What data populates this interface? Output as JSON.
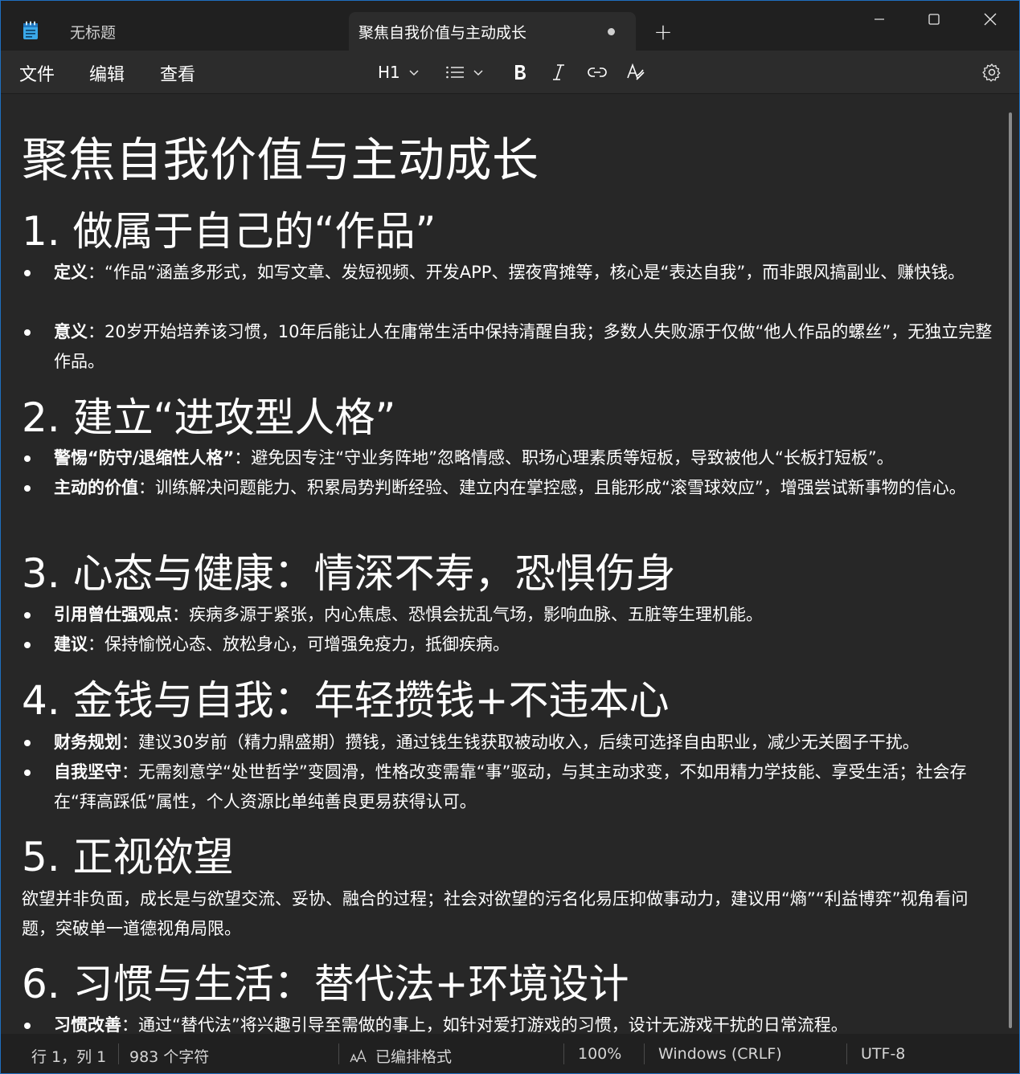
{
  "tabs": [
    {
      "label": "无标题"
    },
    {
      "label": "聚焦自我价值与主动成长"
    }
  ],
  "menu": {
    "file": "文件",
    "edit": "编辑",
    "view": "查看"
  },
  "toolbar": {
    "heading": "H1"
  },
  "doc": {
    "title": "聚焦自我价值与主动成长",
    "s1": {
      "heading": "1. 做属于自己的“作品”",
      "b1_label": "定义",
      "b1_text": "：“作品”涵盖多形式，如写文章、发短视频、开发APP、摆夜宵摊等，核心是“表达自我”，而非跟风搞副业、赚快钱。",
      "b2_label": "意义",
      "b2_text": "：20岁开始培养该习惯，10年后能让人在庸常生活中保持清醒自我；多数人失败源于仅做“他人作品的螺丝”，无独立完整作品。"
    },
    "s2": {
      "heading": "2. 建立“进攻型人格”",
      "b1_label": "警惕“防守/退缩性人格”",
      "b1_text": "：避免因专注“守业务阵地”忽略情感、职场心理素质等短板，导致被他人“长板打短板”。",
      "b2_label": "主动的价值",
      "b2_text": "：训练解决问题能力、积累局势判断经验、建立内在掌控感，且能形成“滚雪球效应”，增强尝试新事物的信心。"
    },
    "s3": {
      "heading": "3. 心态与健康：情深不寿，恐惧伤身",
      "b1_label": "引用曾仕强观点",
      "b1_text": "：疾病多源于紧张，内心焦虑、恐惧会扰乱气场，影响血脉、五脏等生理机能。",
      "b2_label": "建议",
      "b2_text": "：保持愉悦心态、放松身心，可增强免疫力，抵御疾病。"
    },
    "s4": {
      "heading": "4. 金钱与自我：年轻攒钱+不违本心",
      "b1_label": "财务规划",
      "b1_text": "：建议30岁前（精力鼎盛期）攒钱，通过钱生钱获取被动收入，后续可选择自由职业，减少无关圈子干扰。",
      "b2_label": "自我坚守",
      "b2_text": "：无需刻意学“处世哲学”变圆滑，性格改变需靠“事”驱动，与其主动求变，不如用精力学技能、享受生活；社会存在“拜高踩低”属性，个人资源比单纯善良更易获得认可。"
    },
    "s5": {
      "heading": "5. 正视欲望",
      "para": "欲望并非负面，成长是与欲望交流、妥协、融合的过程；社会对欲望的污名化易压抑做事动力，建议用“熵”“利益博弈”视角看问题，突破单一道德视角局限。"
    },
    "s6": {
      "heading": "6. 习惯与生活：替代法+环境设计",
      "b1_label": "习惯改善",
      "b1_text": "：通过“替代法”将兴趣引导至需做的事上，如针对爱打游戏的习惯，设计无游戏干扰的日常流程。"
    }
  },
  "status": {
    "position": "行 1，列 1",
    "chars": "983 个字符",
    "format": "已编排格式",
    "zoom": "100%",
    "line_ending": "Windows (CRLF)",
    "encoding": "UTF-8"
  }
}
